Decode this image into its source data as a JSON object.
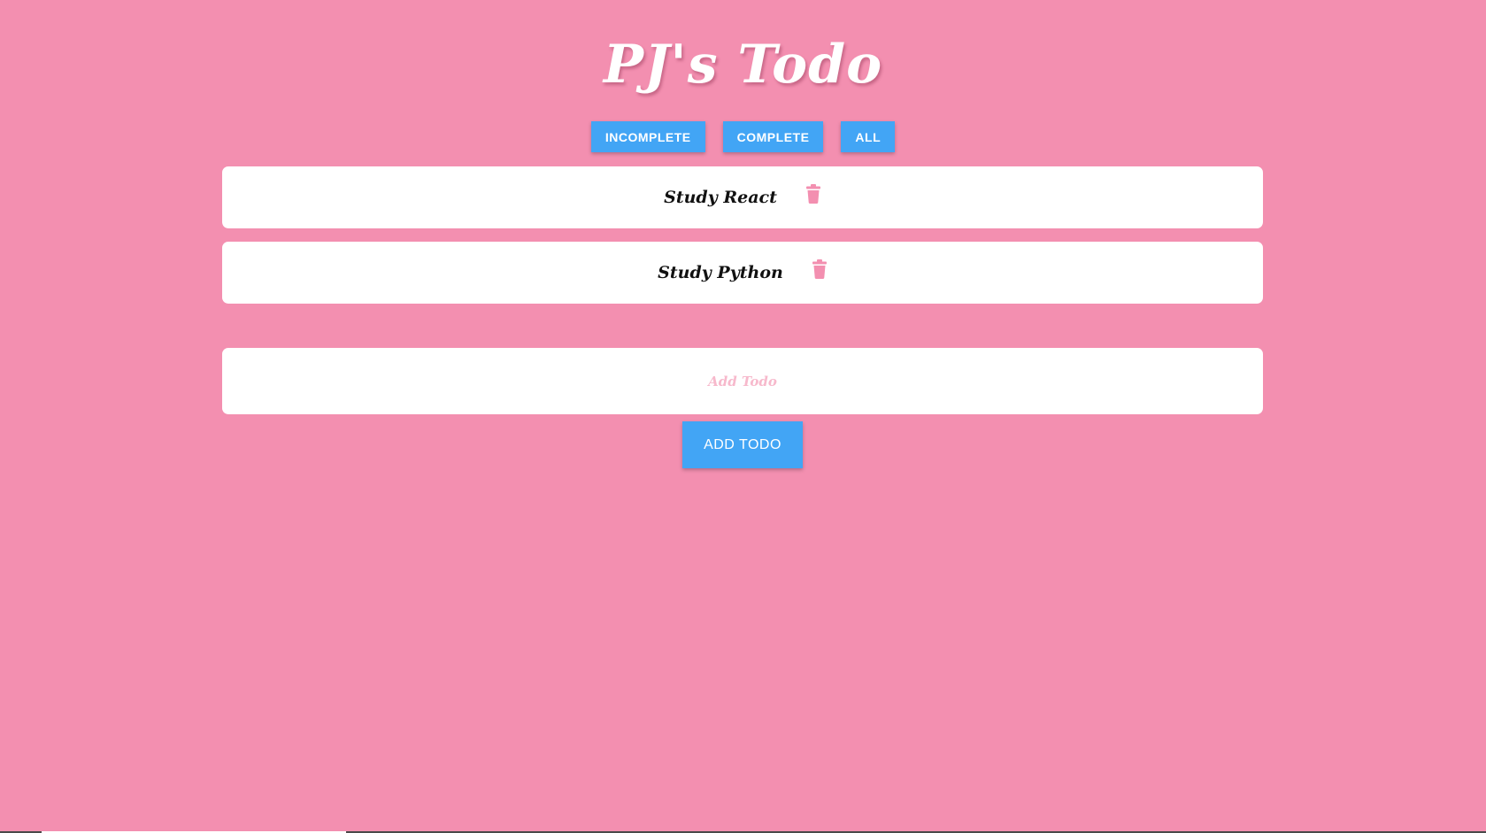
{
  "app": {
    "title": "PJ's Todo"
  },
  "filters": {
    "incomplete_label": "INCOMPLETE",
    "complete_label": "COMPLETE",
    "all_label": "ALL"
  },
  "todos": [
    {
      "text": "Study React"
    },
    {
      "text": "Study Python"
    }
  ],
  "add_form": {
    "placeholder": "Add Todo",
    "value": "",
    "button_label": "ADD TODO"
  },
  "colors": {
    "background": "#f38fb0",
    "accent": "#42a5f5",
    "trash_icon": "#f38fb0",
    "placeholder": "#f7b9cc"
  },
  "icons": {
    "delete": "trash-icon"
  }
}
